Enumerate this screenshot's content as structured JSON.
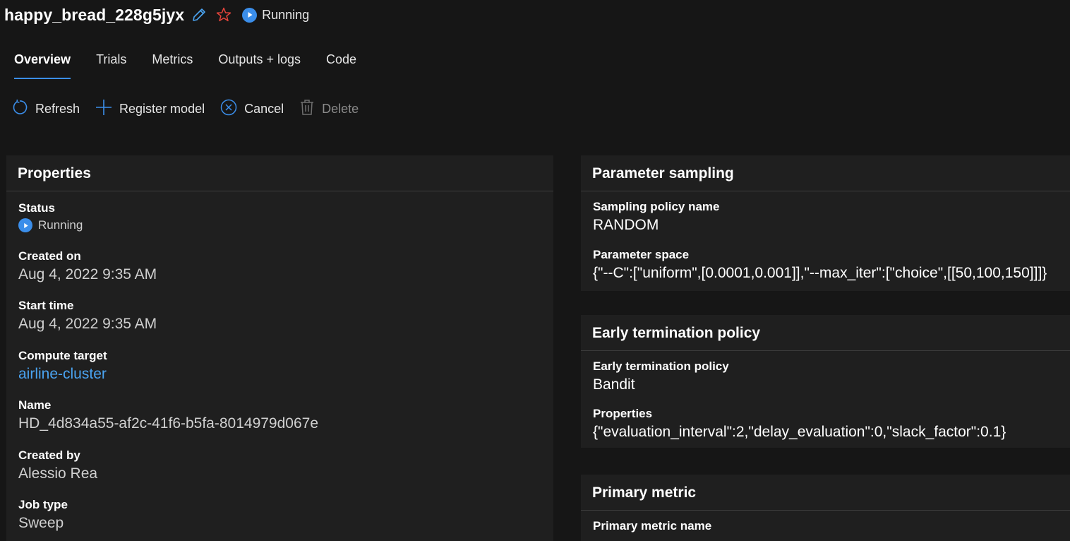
{
  "header": {
    "title": "happy_bread_228g5jyx",
    "status": "Running"
  },
  "tabs": [
    {
      "label": "Overview",
      "active": true
    },
    {
      "label": "Trials",
      "active": false
    },
    {
      "label": "Metrics",
      "active": false
    },
    {
      "label": "Outputs + logs",
      "active": false
    },
    {
      "label": "Code",
      "active": false
    }
  ],
  "toolbar": {
    "refresh_label": "Refresh",
    "register_label": "Register model",
    "cancel_label": "Cancel",
    "delete_label": "Delete"
  },
  "properties": {
    "title": "Properties",
    "status_label": "Status",
    "status_value": "Running",
    "created_on_label": "Created on",
    "created_on_value": "Aug 4, 2022 9:35 AM",
    "start_time_label": "Start time",
    "start_time_value": "Aug 4, 2022 9:35 AM",
    "compute_target_label": "Compute target",
    "compute_target_value": "airline-cluster",
    "name_label": "Name",
    "name_value": "HD_4d834a55-af2c-41f6-b5fa-8014979d067e",
    "created_by_label": "Created by",
    "created_by_value": "Alessio Rea",
    "job_type_label": "Job type",
    "job_type_value": "Sweep"
  },
  "sampling": {
    "title": "Parameter sampling",
    "policy_name_label": "Sampling policy name",
    "policy_name_value": "RANDOM",
    "space_label": "Parameter space",
    "space_value": "{\"--C\":[\"uniform\",[0.0001,0.001]],\"--max_iter\":[\"choice\",[[50,100,150]]]}"
  },
  "early_termination": {
    "title": "Early termination policy",
    "policy_label": "Early termination policy",
    "policy_value": "Bandit",
    "properties_label": "Properties",
    "properties_value": "{\"evaluation_interval\":2,\"delay_evaluation\":0,\"slack_factor\":0.1}"
  },
  "primary_metric": {
    "title": "Primary metric",
    "name_label": "Primary metric name"
  },
  "colors": {
    "background": "#161616",
    "card": "#1f1f1f",
    "accent": "#3b8eea",
    "link": "#4aa3f0",
    "star": "#e8453c"
  },
  "icons": {
    "edit": "pencil-icon",
    "favorite": "star-icon",
    "status": "play-circle-icon",
    "refresh": "refresh-icon",
    "register": "plus-icon",
    "cancel": "cancel-circle-icon",
    "delete": "trash-icon"
  }
}
